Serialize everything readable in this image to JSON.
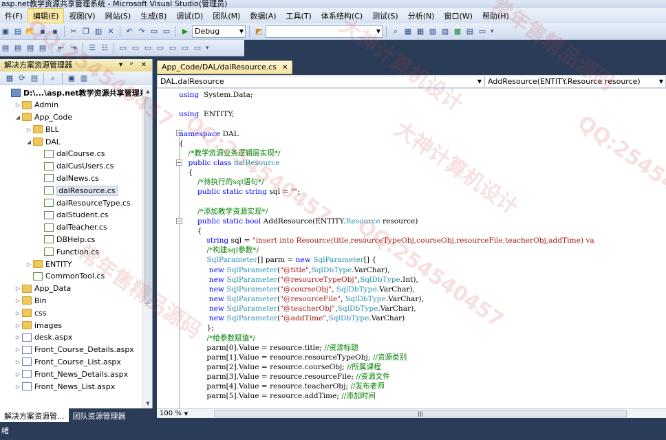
{
  "window": {
    "title": "asp.net教学资源共享管理系统 - Microsoft Visual Studio(管理员)"
  },
  "menu": [
    "件(F)",
    "编辑(E)",
    "视图(V)",
    "网站(S)",
    "生成(B)",
    "调试(D)",
    "团队(M)",
    "数据(A)",
    "工具(T)",
    "体系结构(C)",
    "测试(S)",
    "分析(N)",
    "窗口(W)",
    "帮助(H)"
  ],
  "toolbar": {
    "config": "Debug",
    "search": ""
  },
  "solution_explorer": {
    "title": "解决方案资源管理器",
    "controls": "▾ ᵖ ✕",
    "tree": [
      {
        "label": "D:\\...\\asp.net教学资源共享管理系统",
        "depth": 0,
        "type": "proj",
        "exp": "",
        "bold": true
      },
      {
        "label": "Admin",
        "depth": 1,
        "type": "folder",
        "exp": "▷"
      },
      {
        "label": "App_Code",
        "depth": 1,
        "type": "folder",
        "exp": "◢"
      },
      {
        "label": "BLL",
        "depth": 2,
        "type": "folder",
        "exp": "▷"
      },
      {
        "label": "DAL",
        "depth": 2,
        "type": "folder",
        "exp": "◢"
      },
      {
        "label": "dalCourse.cs",
        "depth": 3,
        "type": "file",
        "exp": ""
      },
      {
        "label": "dalCusUsers.cs",
        "depth": 3,
        "type": "file",
        "exp": ""
      },
      {
        "label": "dalNews.cs",
        "depth": 3,
        "type": "file",
        "exp": ""
      },
      {
        "label": "dalResource.cs",
        "depth": 3,
        "type": "file",
        "exp": "",
        "selected": true
      },
      {
        "label": "dalResourceType.cs",
        "depth": 3,
        "type": "file",
        "exp": ""
      },
      {
        "label": "dalStudent.cs",
        "depth": 3,
        "type": "file",
        "exp": ""
      },
      {
        "label": "dalTeacher.cs",
        "depth": 3,
        "type": "file",
        "exp": ""
      },
      {
        "label": "DBHelp.cs",
        "depth": 3,
        "type": "file",
        "exp": ""
      },
      {
        "label": "Function.cs",
        "depth": 3,
        "type": "file",
        "exp": ""
      },
      {
        "label": "ENTITY",
        "depth": 2,
        "type": "folder",
        "exp": "▷"
      },
      {
        "label": "CommonTool.cs",
        "depth": 2,
        "type": "file",
        "exp": ""
      },
      {
        "label": "App_Data",
        "depth": 1,
        "type": "folder",
        "exp": "▷"
      },
      {
        "label": "Bin",
        "depth": 1,
        "type": "folder",
        "exp": "▷"
      },
      {
        "label": "css",
        "depth": 1,
        "type": "folder",
        "exp": "▷"
      },
      {
        "label": "images",
        "depth": 1,
        "type": "folder",
        "exp": "▷"
      },
      {
        "label": "desk.aspx",
        "depth": 1,
        "type": "page",
        "exp": "▷"
      },
      {
        "label": "Front_Course_Details.aspx",
        "depth": 1,
        "type": "page",
        "exp": "▷"
      },
      {
        "label": "Front_Course_List.aspx",
        "depth": 1,
        "type": "page",
        "exp": "▷"
      },
      {
        "label": "Front_News_Details.aspx",
        "depth": 1,
        "type": "page",
        "exp": "▷"
      },
      {
        "label": "Front_News_List.aspx",
        "depth": 1,
        "type": "page",
        "exp": "▷"
      }
    ],
    "tabs": [
      "解决方案资源管...",
      "团队资源管理器"
    ]
  },
  "editor": {
    "tab_label": "App_Code/DAL/dalResource.cs",
    "nav_left": "DAL.dalResource",
    "nav_right": "AddResource(ENTITY.Resource resource)",
    "zoom": "100 %",
    "lines": [
      [
        [
          "kw",
          "using"
        ],
        [
          "",
          "  System.Data;"
        ]
      ],
      [],
      [
        [
          "kw",
          "using"
        ],
        [
          "",
          "  ENTITY;"
        ]
      ],
      [],
      [
        [
          "kw",
          "namespace"
        ],
        [
          "",
          " DAL"
        ]
      ],
      [
        [
          "",
          "{"
        ]
      ],
      [
        [
          "",
          "    "
        ],
        [
          "cm",
          "/*教学资源业务逻辑层实现*/"
        ]
      ],
      [
        [
          "",
          "    "
        ],
        [
          "kw",
          "public class"
        ],
        [
          "",
          ""
        ],
        [
          "ty",
          " dalResource"
        ]
      ],
      [
        [
          "",
          "    {"
        ]
      ],
      [
        [
          "",
          "        "
        ],
        [
          "cm",
          "/*待执行的sql语句*/"
        ]
      ],
      [
        [
          "",
          "        "
        ],
        [
          "kw",
          "public static string"
        ],
        [
          "",
          " sql = "
        ],
        [
          "st",
          "\"\""
        ],
        [
          "",
          ";"
        ]
      ],
      [],
      [
        [
          "",
          "        "
        ],
        [
          "cm",
          "/*添加教学资源实现*/"
        ]
      ],
      [
        [
          "",
          "        "
        ],
        [
          "kw",
          "public static bool"
        ],
        [
          "",
          " AddResource(ENTITY."
        ],
        [
          "ty",
          "Resource"
        ],
        [
          "",
          " resource)"
        ]
      ],
      [
        [
          "",
          "        {"
        ]
      ],
      [
        [
          "",
          "            "
        ],
        [
          "kw",
          "string"
        ],
        [
          "",
          " sql = "
        ],
        [
          "st",
          "\"insert into Resource(title,resourceTypeObj,courseObj,resourceFile,teacherObj,addTime) va"
        ]
      ],
      [
        [
          "",
          "            "
        ],
        [
          "cm",
          "/*构建sql参数*/"
        ]
      ],
      [
        [
          "",
          "            "
        ],
        [
          "ty",
          "SqlParameter"
        ],
        [
          "",
          "[] parm = "
        ],
        [
          "kw",
          "new"
        ],
        [
          "ty",
          " SqlParameter"
        ],
        [
          "",
          "[] {"
        ]
      ],
      [
        [
          "",
          "             "
        ],
        [
          "kw",
          "new"
        ],
        [
          "ty",
          " SqlParameter"
        ],
        [
          "",
          "("
        ],
        [
          "st",
          "\"@title\""
        ],
        [
          "",
          ","
        ],
        [
          "ty",
          "SqlDbType"
        ],
        [
          "",
          ".VarChar),"
        ]
      ],
      [
        [
          "",
          "             "
        ],
        [
          "kw",
          "new"
        ],
        [
          "ty",
          " SqlParameter"
        ],
        [
          "",
          "("
        ],
        [
          "st",
          "\"@resourceTypeObj\""
        ],
        [
          "",
          ","
        ],
        [
          "ty",
          "SqlDbType"
        ],
        [
          "",
          ".Int),"
        ]
      ],
      [
        [
          "",
          "             "
        ],
        [
          "kw",
          "new"
        ],
        [
          "ty",
          " SqlParameter"
        ],
        [
          "",
          "("
        ],
        [
          "st",
          "\"@courseObj\""
        ],
        [
          "",
          ", "
        ],
        [
          "ty",
          "SqlDbType"
        ],
        [
          "",
          ".VarChar),"
        ]
      ],
      [
        [
          "",
          "             "
        ],
        [
          "kw",
          "new"
        ],
        [
          "ty",
          " SqlParameter"
        ],
        [
          "",
          "("
        ],
        [
          "st",
          "\"@resourceFile\""
        ],
        [
          "",
          ", "
        ],
        [
          "ty",
          "SqlDbType"
        ],
        [
          "",
          ".VarChar),"
        ]
      ],
      [
        [
          "",
          "             "
        ],
        [
          "kw",
          "new"
        ],
        [
          "ty",
          " SqlParameter"
        ],
        [
          "",
          "("
        ],
        [
          "st",
          "\"@teacherObj\""
        ],
        [
          "",
          ","
        ],
        [
          "ty",
          "SqlDbType"
        ],
        [
          "",
          ".VarChar),"
        ]
      ],
      [
        [
          "",
          "             "
        ],
        [
          "kw",
          "new"
        ],
        [
          "ty",
          " SqlParameter"
        ],
        [
          "",
          "("
        ],
        [
          "st",
          "\"@addTime\""
        ],
        [
          "",
          ","
        ],
        [
          "ty",
          "SqlDbType"
        ],
        [
          "",
          ".VarChar)"
        ]
      ],
      [
        [
          "",
          "            };"
        ]
      ],
      [
        [
          "",
          "            "
        ],
        [
          "cm",
          "/*给参数赋值*/"
        ]
      ],
      [
        [
          "",
          "            parm[0].Value = resource.title; "
        ],
        [
          "cm",
          "//资源标题"
        ]
      ],
      [
        [
          "",
          "            parm[1].Value = resource.resourceTypeObj; "
        ],
        [
          "cm",
          "//资源类别"
        ]
      ],
      [
        [
          "",
          "            parm[2].Value = resource.courseObj; "
        ],
        [
          "cm",
          "//所属课程"
        ]
      ],
      [
        [
          "",
          "            parm[3].Value = resource.resourceFile; "
        ],
        [
          "cm",
          "//资源文件"
        ]
      ],
      [
        [
          "",
          "            parm[4].Value = resource.teacherObj; "
        ],
        [
          "cm",
          "//发布老师"
        ]
      ],
      [
        [
          "",
          "            parm[5].Value = resource.addTime; "
        ],
        [
          "cm",
          "//添加时间"
        ]
      ]
    ]
  },
  "status": {
    "text": "绪"
  },
  "watermarks": [
    "QQ:254540457",
    "大神计算机设计",
    "常年售精品源码",
    "QQ:254540457",
    "大神计算机设计",
    "QQ:254540457",
    "常年售精品源码",
    "QQ:254540457"
  ]
}
